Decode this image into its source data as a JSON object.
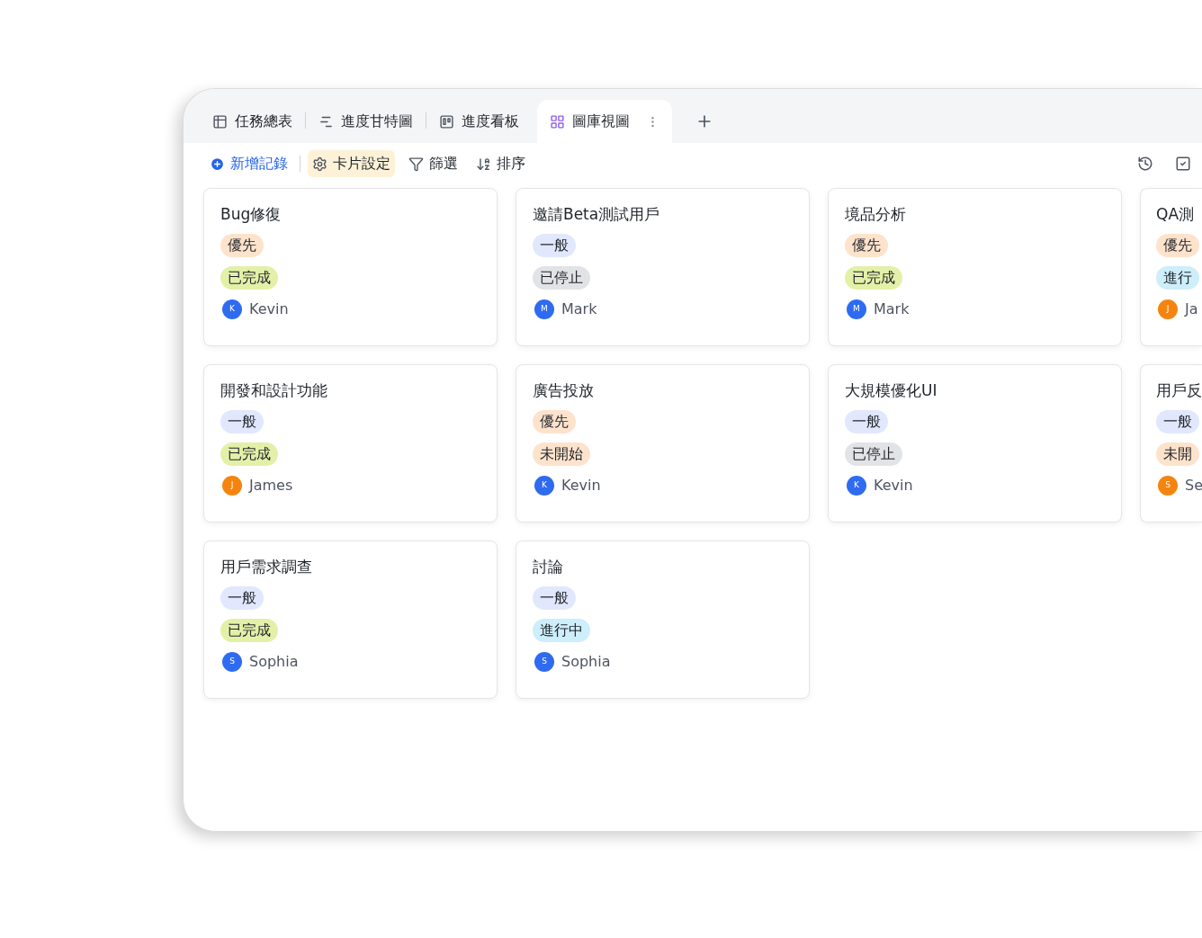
{
  "tabs": [
    {
      "label": "任務總表",
      "kind": "table",
      "selected": false
    },
    {
      "label": "進度甘特圖",
      "kind": "gantt",
      "selected": false
    },
    {
      "label": "進度看板",
      "kind": "kanban",
      "selected": false
    },
    {
      "label": "圖庫視圖",
      "kind": "gallery",
      "selected": true
    }
  ],
  "toolbar": [
    {
      "label": "新增記錄",
      "kind": "add",
      "active": false
    },
    {
      "label": "卡片設定",
      "kind": "settings",
      "active": true
    },
    {
      "label": "篩選",
      "kind": "filter",
      "active": false
    },
    {
      "label": "排序",
      "kind": "sort",
      "active": false
    }
  ],
  "cards": [
    {
      "title": "Bug修復",
      "priority": {
        "label": "優先",
        "color": "#fde3cc"
      },
      "status": {
        "label": "已完成",
        "color": "#e3f0a8"
      },
      "assignee": {
        "initial": "K",
        "name": "Kevin",
        "color": "#2f6bf0"
      }
    },
    {
      "title": "邀請Beta測試用戶",
      "priority": {
        "label": "一般",
        "color": "#e1e8fd"
      },
      "status": {
        "label": "已停止",
        "color": "#e2e3e6"
      },
      "assignee": {
        "initial": "M",
        "name": "Mark",
        "color": "#2f6bf0"
      }
    },
    {
      "title": "境品分析",
      "priority": {
        "label": "優先",
        "color": "#fde3cc"
      },
      "status": {
        "label": "已完成",
        "color": "#e3f0a8"
      },
      "assignee": {
        "initial": "M",
        "name": "Mark",
        "color": "#2f6bf0"
      }
    },
    {
      "title": "QA測",
      "priority": {
        "label": "優先",
        "color": "#fde3cc"
      },
      "status": {
        "label": "進行",
        "color": "#cdeefb"
      },
      "assignee": {
        "initial": "J",
        "name": "Ja",
        "color": "#f5840f"
      }
    },
    {
      "title": "開發和設計功能",
      "priority": {
        "label": "一般",
        "color": "#e1e8fd"
      },
      "status": {
        "label": "已完成",
        "color": "#e3f0a8"
      },
      "assignee": {
        "initial": "J",
        "name": "James",
        "color": "#f5840f"
      }
    },
    {
      "title": "廣告投放",
      "priority": {
        "label": "優先",
        "color": "#fde3cc"
      },
      "status": {
        "label": "未開始",
        "color": "#fde3cc"
      },
      "assignee": {
        "initial": "K",
        "name": "Kevin",
        "color": "#2f6bf0"
      }
    },
    {
      "title": "大規模優化UI",
      "priority": {
        "label": "一般",
        "color": "#e1e8fd"
      },
      "status": {
        "label": "已停止",
        "color": "#e2e3e6"
      },
      "assignee": {
        "initial": "K",
        "name": "Kevin",
        "color": "#2f6bf0"
      }
    },
    {
      "title": "用戶反",
      "priority": {
        "label": "一般",
        "color": "#e1e8fd"
      },
      "status": {
        "label": "未開",
        "color": "#fde3cc"
      },
      "assignee": {
        "initial": "S",
        "name": "Se",
        "color": "#f5840f"
      }
    },
    {
      "title": "用戶需求調查",
      "priority": {
        "label": "一般",
        "color": "#e1e8fd"
      },
      "status": {
        "label": "已完成",
        "color": "#e3f0a8"
      },
      "assignee": {
        "initial": "S",
        "name": "Sophia",
        "color": "#2f6bf0"
      }
    },
    {
      "title": "討論",
      "priority": {
        "label": "一般",
        "color": "#e1e8fd"
      },
      "status": {
        "label": "進行中",
        "color": "#cdeefb"
      },
      "assignee": {
        "initial": "S",
        "name": "Sophia",
        "color": "#2f6bf0"
      }
    }
  ]
}
